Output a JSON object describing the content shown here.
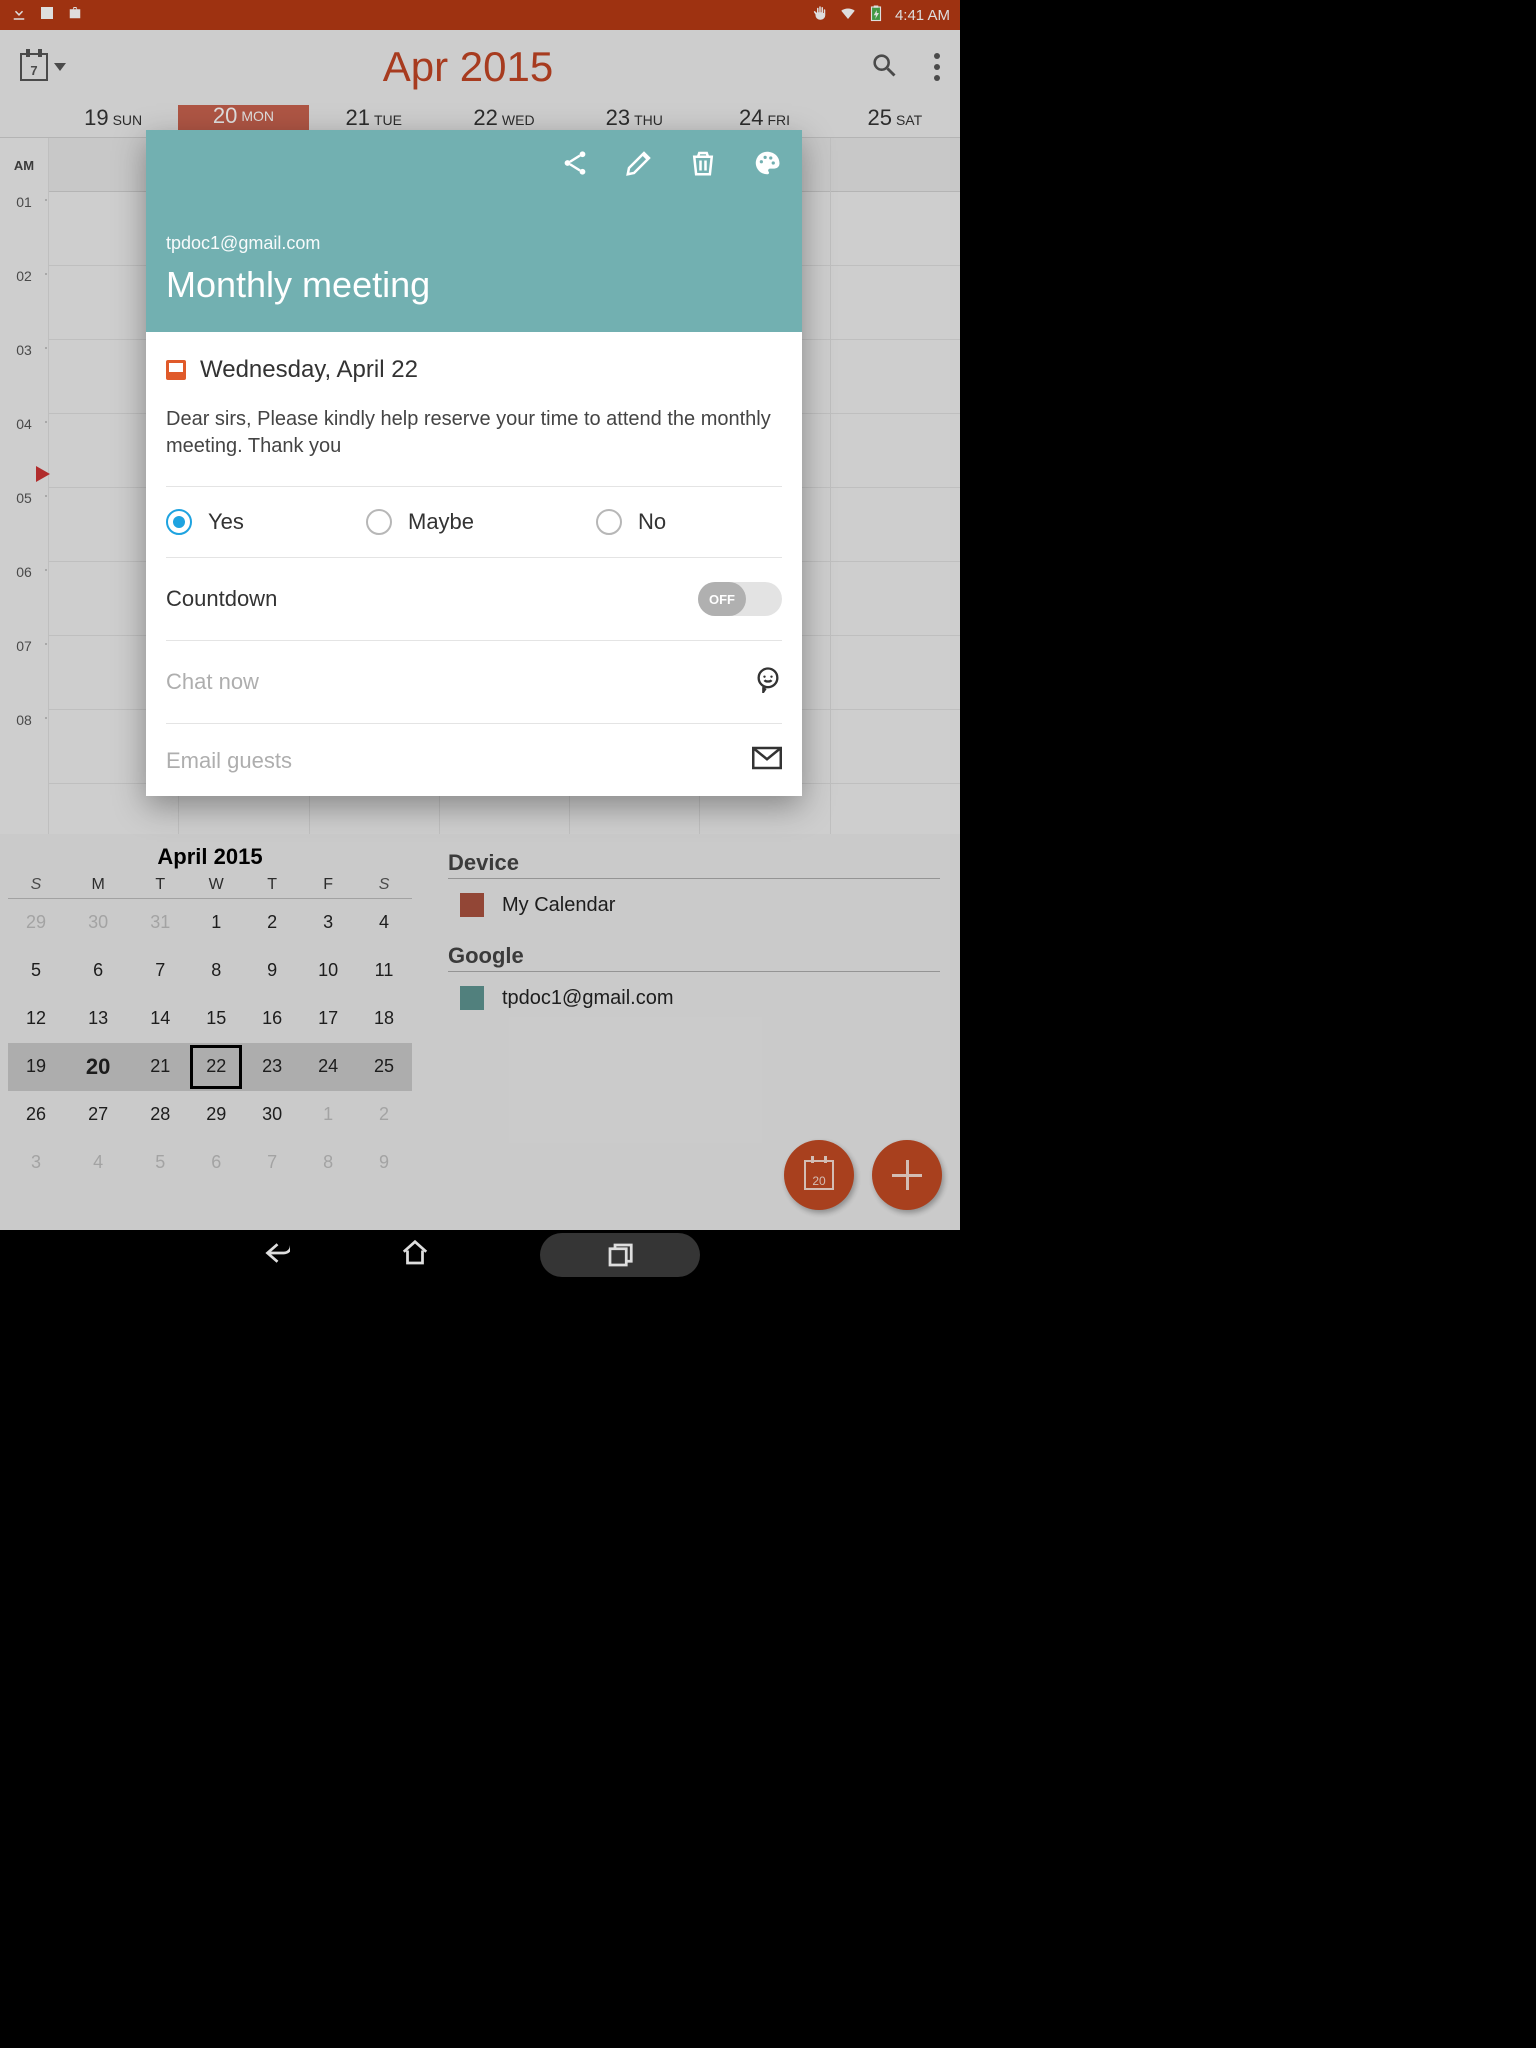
{
  "status": {
    "time": "4:41 AM"
  },
  "header": {
    "calendar_icon_day": "7",
    "title": "Apr 2015"
  },
  "week": {
    "days": [
      {
        "num": "19",
        "dow": "SUN"
      },
      {
        "num": "20",
        "dow": "MON",
        "selected": true
      },
      {
        "num": "21",
        "dow": "TUE"
      },
      {
        "num": "22",
        "dow": "WED"
      },
      {
        "num": "23",
        "dow": "THU"
      },
      {
        "num": "24",
        "dow": "FRI"
      },
      {
        "num": "25",
        "dow": "SAT"
      }
    ]
  },
  "hours": {
    "ampm": "AM",
    "labels": [
      "01",
      "02",
      "03",
      "04",
      "05",
      "06",
      "07",
      "08"
    ]
  },
  "mini": {
    "title": "April 2015",
    "dow": [
      "S",
      "M",
      "T",
      "W",
      "T",
      "F",
      "S"
    ],
    "rows": [
      [
        {
          "d": "29",
          "dim": true
        },
        {
          "d": "30",
          "dim": true
        },
        {
          "d": "31",
          "dim": true
        },
        {
          "d": "1"
        },
        {
          "d": "2"
        },
        {
          "d": "3"
        },
        {
          "d": "4"
        }
      ],
      [
        {
          "d": "5"
        },
        {
          "d": "6"
        },
        {
          "d": "7"
        },
        {
          "d": "8"
        },
        {
          "d": "9"
        },
        {
          "d": "10"
        },
        {
          "d": "11"
        }
      ],
      [
        {
          "d": "12"
        },
        {
          "d": "13"
        },
        {
          "d": "14"
        },
        {
          "d": "15"
        },
        {
          "d": "16"
        },
        {
          "d": "17"
        },
        {
          "d": "18"
        }
      ],
      [
        {
          "d": "19"
        },
        {
          "d": "20",
          "today": true
        },
        {
          "d": "21"
        },
        {
          "d": "22",
          "box": true
        },
        {
          "d": "23"
        },
        {
          "d": "24"
        },
        {
          "d": "25"
        }
      ],
      [
        {
          "d": "26"
        },
        {
          "d": "27"
        },
        {
          "d": "28"
        },
        {
          "d": "29"
        },
        {
          "d": "30"
        },
        {
          "d": "1",
          "dim": true
        },
        {
          "d": "2",
          "dim": true
        }
      ],
      [
        {
          "d": "3",
          "dim": true
        },
        {
          "d": "4",
          "dim": true
        },
        {
          "d": "5",
          "dim": true
        },
        {
          "d": "6",
          "dim": true
        },
        {
          "d": "7",
          "dim": true
        },
        {
          "d": "8",
          "dim": true
        },
        {
          "d": "9",
          "dim": true
        }
      ]
    ],
    "current_week_index": 3
  },
  "accounts": {
    "sections": [
      {
        "title": "Device",
        "items": [
          {
            "color": "#a8513f",
            "label": "My Calendar"
          }
        ]
      },
      {
        "title": "Google",
        "items": [
          {
            "color": "#5e9390",
            "label": "tpdoc1@gmail.com"
          }
        ]
      }
    ]
  },
  "fab_today_day": "20",
  "dialog": {
    "email": "tpdoc1@gmail.com",
    "title": "Monthly meeting",
    "date": "Wednesday, April 22",
    "description": "Dear sirs, Please kindly help reserve your time to attend the monthly meeting. Thank you",
    "rsvp": {
      "yes": "Yes",
      "maybe": "Maybe",
      "no": "No",
      "selected": "yes"
    },
    "countdown_label": "Countdown",
    "countdown_state": "OFF",
    "chat_label": "Chat now",
    "email_guests_label": "Email guests"
  }
}
